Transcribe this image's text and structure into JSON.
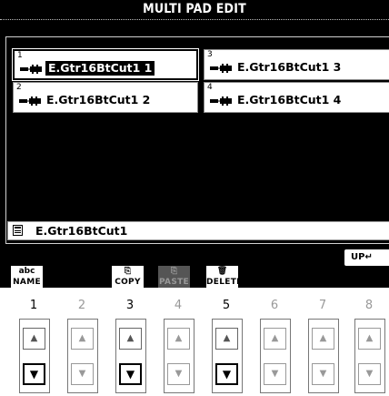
{
  "header": {
    "title": "MULTI PAD EDIT"
  },
  "pads": [
    {
      "number": "1",
      "name": "E.Gtr16BtCut1 1",
      "selected": true
    },
    {
      "number": "3",
      "name": "E.Gtr16BtCut1 3",
      "selected": false
    },
    {
      "number": "2",
      "name": "E.Gtr16BtCut1 2",
      "selected": false
    },
    {
      "number": "4",
      "name": "E.Gtr16BtCut1 4",
      "selected": false
    }
  ],
  "bank": {
    "icon": "file-icon",
    "name": "E.Gtr16BtCut1"
  },
  "up_button": {
    "label": "UP",
    "icon": "return-arrow-icon"
  },
  "functions": {
    "name": {
      "icon": "abc",
      "label": "NAME",
      "enabled": true
    },
    "copy": {
      "label": "COPY",
      "enabled": true
    },
    "paste": {
      "label": "PASTE",
      "enabled": false
    },
    "delete": {
      "label": "DELETE",
      "enabled": true
    }
  },
  "buttons": {
    "numbers": [
      "1",
      "2",
      "3",
      "4",
      "5",
      "6",
      "7",
      "8"
    ],
    "active_columns": [
      "1",
      "3",
      "5"
    ]
  },
  "colors": {
    "screen": "#000000",
    "highlight": "#ffffff",
    "disabled": "#555555"
  }
}
